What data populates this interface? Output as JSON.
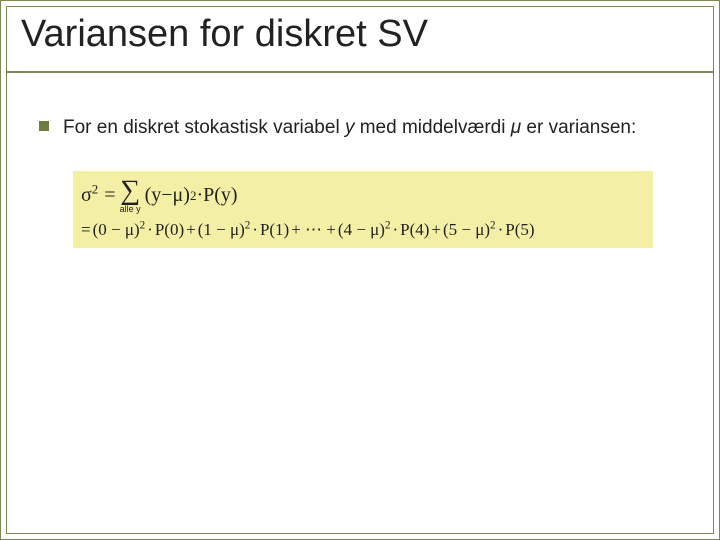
{
  "title": "Variansen for diskret SV",
  "bullet": {
    "pre": "For en diskret stokastisk variabel ",
    "var": "y",
    "mid": " med middelværdi ",
    "mu": "μ",
    "post": " er variansen:"
  },
  "eq": {
    "lhs": "σ",
    "sq": "2",
    "eq": " = ",
    "sum_sub": "alle y",
    "term_open": "(",
    "term_y": "y",
    "term_minus": " − ",
    "term_mu": "μ",
    "term_close_sq": ")",
    "dot": " · ",
    "Py": "P(y)",
    "line2_lead": "= ",
    "t0": "(0 − μ)",
    "p0": "P(0)",
    "plus": " + ",
    "t1": "(1 − μ)",
    "p1": "P(1)",
    "ellipsis": " + ⋯ + ",
    "t4": "(4 − μ)",
    "p4": "P(4)",
    "t5": "(5 − μ)",
    "p5": "P(5)"
  },
  "chart_data": {
    "type": "table",
    "title": "Variance of discrete random variable",
    "definition": "σ² = Σ_{all y} (y − μ)² · P(y)",
    "expansion_terms": [
      {
        "y": 0,
        "term": "(0 − μ)² · P(0)"
      },
      {
        "y": 1,
        "term": "(1 − μ)² · P(1)"
      },
      {
        "y": "…",
        "term": "…"
      },
      {
        "y": 4,
        "term": "(4 − μ)² · P(4)"
      },
      {
        "y": 5,
        "term": "(5 − μ)² · P(5)"
      }
    ]
  }
}
